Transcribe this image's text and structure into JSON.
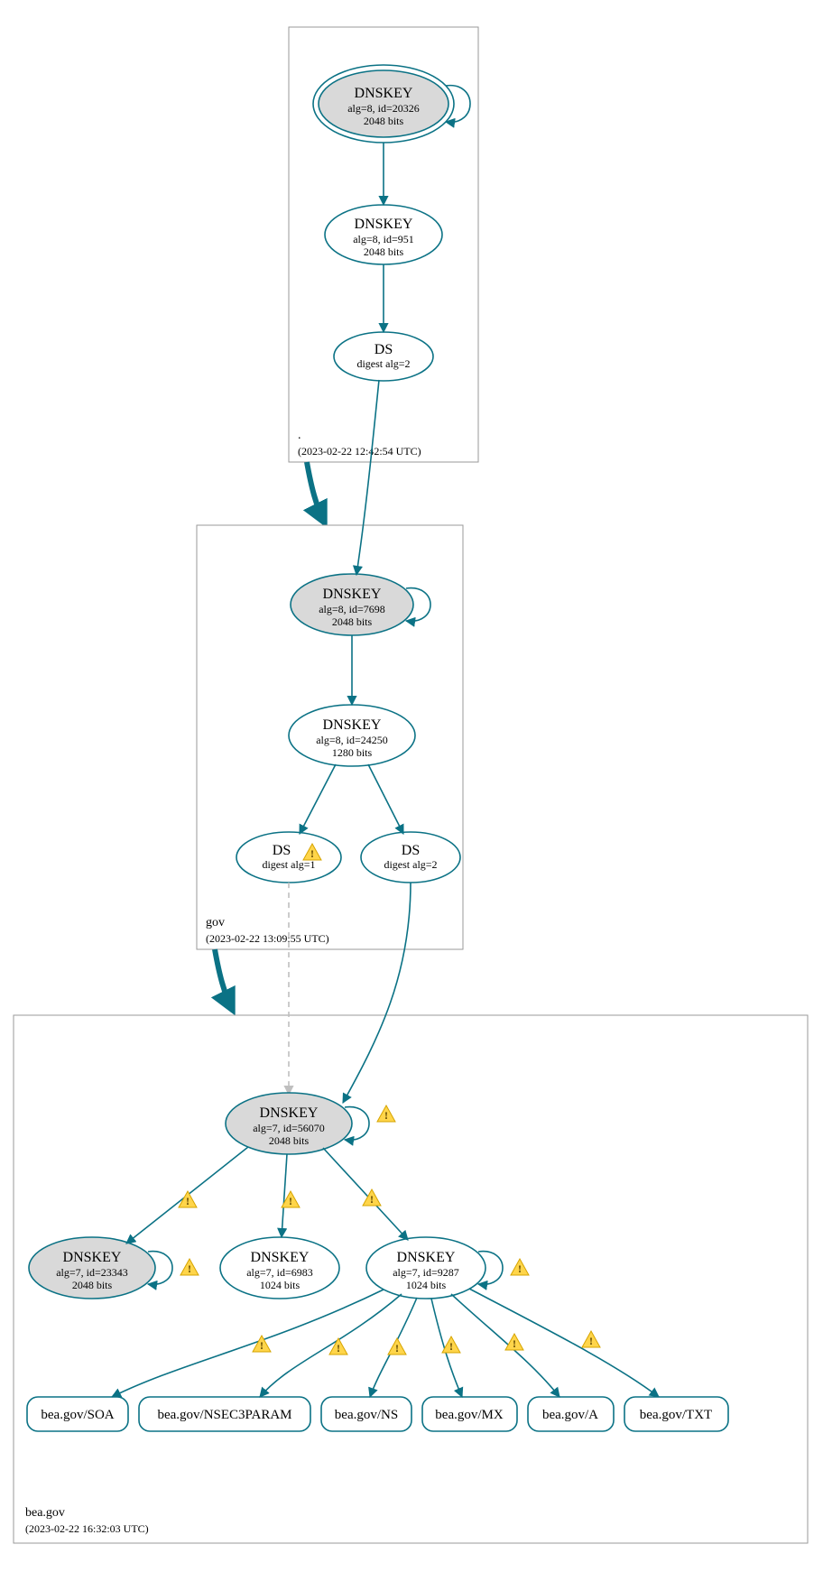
{
  "colors": {
    "stroke": "#0b7285",
    "fill_grey": "#d9d9d9",
    "fill_white": "#ffffff",
    "box_stroke": "#9a9a9a",
    "dashed": "#bfbfbf",
    "warn_fill": "#ffd54a",
    "warn_stroke": "#d6a400"
  },
  "zones": {
    "root": {
      "name": ".",
      "timestamp": "(2023-02-22 12:42:54 UTC)"
    },
    "gov": {
      "name": "gov",
      "timestamp": "(2023-02-22 13:09:55 UTC)"
    },
    "bea": {
      "name": "bea.gov",
      "timestamp": "(2023-02-22 16:32:03 UTC)"
    }
  },
  "nodes": {
    "root_ksk": {
      "title": "DNSKEY",
      "sub1": "alg=8, id=20326",
      "sub2": "2048 bits"
    },
    "root_zsk": {
      "title": "DNSKEY",
      "sub1": "alg=8, id=951",
      "sub2": "2048 bits"
    },
    "root_ds": {
      "title": "DS",
      "sub1": "digest alg=2"
    },
    "gov_ksk": {
      "title": "DNSKEY",
      "sub1": "alg=8, id=7698",
      "sub2": "2048 bits"
    },
    "gov_zsk": {
      "title": "DNSKEY",
      "sub1": "alg=8, id=24250",
      "sub2": "1280 bits"
    },
    "gov_ds1": {
      "title": "DS",
      "sub1": "digest alg=1"
    },
    "gov_ds2": {
      "title": "DS",
      "sub1": "digest alg=2"
    },
    "bea_ksk": {
      "title": "DNSKEY",
      "sub1": "alg=7, id=56070",
      "sub2": "2048 bits"
    },
    "bea_k2": {
      "title": "DNSKEY",
      "sub1": "alg=7, id=23343",
      "sub2": "2048 bits"
    },
    "bea_k3": {
      "title": "DNSKEY",
      "sub1": "alg=7, id=6983",
      "sub2": "1024 bits"
    },
    "bea_k4": {
      "title": "DNSKEY",
      "sub1": "alg=7, id=9287",
      "sub2": "1024 bits"
    }
  },
  "rrsets": {
    "soa": "bea.gov/SOA",
    "n3p": "bea.gov/NSEC3PARAM",
    "ns": "bea.gov/NS",
    "mx": "bea.gov/MX",
    "a": "bea.gov/A",
    "txt": "bea.gov/TXT"
  },
  "chart_data": {
    "type": "graph",
    "description": "DNSSEC delegation / signing hierarchy (DNSViz-style)",
    "zones": [
      {
        "id": "root",
        "name": ".",
        "timestamp": "2023-02-22 12:42:54 UTC"
      },
      {
        "id": "gov",
        "name": "gov",
        "timestamp": "2023-02-22 13:09:55 UTC"
      },
      {
        "id": "bea",
        "name": "bea.gov",
        "timestamp": "2023-02-22 16:32:03 UTC"
      }
    ],
    "nodes": [
      {
        "id": "root_ksk",
        "zone": "root",
        "type": "DNSKEY",
        "alg": 8,
        "key_id": 20326,
        "bits": 2048,
        "sep": true,
        "shaded": true
      },
      {
        "id": "root_zsk",
        "zone": "root",
        "type": "DNSKEY",
        "alg": 8,
        "key_id": 951,
        "bits": 2048,
        "shaded": false
      },
      {
        "id": "root_ds",
        "zone": "root",
        "type": "DS",
        "digest_alg": 2
      },
      {
        "id": "gov_ksk",
        "zone": "gov",
        "type": "DNSKEY",
        "alg": 8,
        "key_id": 7698,
        "bits": 2048,
        "shaded": true
      },
      {
        "id": "gov_zsk",
        "zone": "gov",
        "type": "DNSKEY",
        "alg": 8,
        "key_id": 24250,
        "bits": 1280,
        "shaded": false
      },
      {
        "id": "gov_ds1",
        "zone": "gov",
        "type": "DS",
        "digest_alg": 1,
        "warning": true
      },
      {
        "id": "gov_ds2",
        "zone": "gov",
        "type": "DS",
        "digest_alg": 2
      },
      {
        "id": "bea_ksk",
        "zone": "bea",
        "type": "DNSKEY",
        "alg": 7,
        "key_id": 56070,
        "bits": 2048,
        "shaded": true
      },
      {
        "id": "bea_k2",
        "zone": "bea",
        "type": "DNSKEY",
        "alg": 7,
        "key_id": 23343,
        "bits": 2048,
        "shaded": true
      },
      {
        "id": "bea_k3",
        "zone": "bea",
        "type": "DNSKEY",
        "alg": 7,
        "key_id": 6983,
        "bits": 1024,
        "shaded": false
      },
      {
        "id": "bea_k4",
        "zone": "bea",
        "type": "DNSKEY",
        "alg": 7,
        "key_id": 9287,
        "bits": 1024,
        "shaded": false
      },
      {
        "id": "rr_soa",
        "zone": "bea",
        "type": "RRset",
        "name": "bea.gov/SOA"
      },
      {
        "id": "rr_n3p",
        "zone": "bea",
        "type": "RRset",
        "name": "bea.gov/NSEC3PARAM"
      },
      {
        "id": "rr_ns",
        "zone": "bea",
        "type": "RRset",
        "name": "bea.gov/NS"
      },
      {
        "id": "rr_mx",
        "zone": "bea",
        "type": "RRset",
        "name": "bea.gov/MX"
      },
      {
        "id": "rr_a",
        "zone": "bea",
        "type": "RRset",
        "name": "bea.gov/A"
      },
      {
        "id": "rr_txt",
        "zone": "bea",
        "type": "RRset",
        "name": "bea.gov/TXT"
      }
    ],
    "edges": [
      {
        "from": "root_ksk",
        "to": "root_ksk",
        "self": true
      },
      {
        "from": "root_ksk",
        "to": "root_zsk"
      },
      {
        "from": "root_zsk",
        "to": "root_ds"
      },
      {
        "from": "root_ds",
        "to": "gov_ksk"
      },
      {
        "from": "gov_ksk",
        "to": "gov_ksk",
        "self": true
      },
      {
        "from": "gov_ksk",
        "to": "gov_zsk"
      },
      {
        "from": "gov_zsk",
        "to": "gov_ds1"
      },
      {
        "from": "gov_zsk",
        "to": "gov_ds2"
      },
      {
        "from": "gov_ds1",
        "to": "bea_ksk",
        "dashed": true
      },
      {
        "from": "gov_ds2",
        "to": "bea_ksk"
      },
      {
        "from": "bea_ksk",
        "to": "bea_ksk",
        "self": true,
        "warning": true
      },
      {
        "from": "bea_ksk",
        "to": "bea_k2",
        "warning": true
      },
      {
        "from": "bea_ksk",
        "to": "bea_k3",
        "warning": true
      },
      {
        "from": "bea_ksk",
        "to": "bea_k4",
        "warning": true
      },
      {
        "from": "bea_k2",
        "to": "bea_k2",
        "self": true,
        "warning": true
      },
      {
        "from": "bea_k4",
        "to": "bea_k4",
        "self": true,
        "warning": true
      },
      {
        "from": "bea_k4",
        "to": "rr_soa",
        "warning": true
      },
      {
        "from": "bea_k4",
        "to": "rr_n3p",
        "warning": true
      },
      {
        "from": "bea_k4",
        "to": "rr_ns",
        "warning": true
      },
      {
        "from": "bea_k4",
        "to": "rr_mx",
        "warning": true
      },
      {
        "from": "bea_k4",
        "to": "rr_a",
        "warning": true
      },
      {
        "from": "bea_k4",
        "to": "rr_txt",
        "warning": true
      }
    ],
    "zone_delegations": [
      {
        "from": "root",
        "to": "gov",
        "thick": true
      },
      {
        "from": "gov",
        "to": "bea",
        "thick": true
      }
    ]
  }
}
